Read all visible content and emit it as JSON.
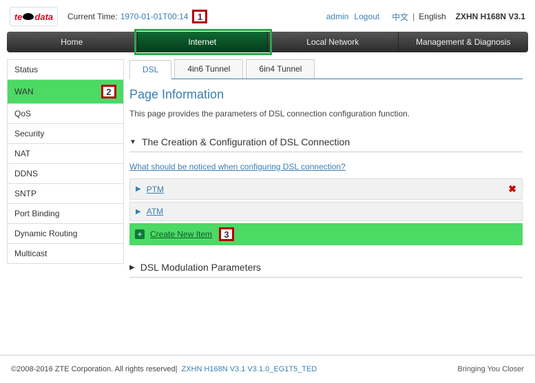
{
  "header": {
    "logo_te": "te",
    "logo_data": "data",
    "time_label": "Current Time:",
    "time_value": "1970-01-01T00:14",
    "user": "admin",
    "logout": "Logout",
    "lang_cn": "中文",
    "lang_en": "English",
    "model": "ZXHN H168N V3.1"
  },
  "steps": {
    "one": "1",
    "two": "2",
    "three": "3"
  },
  "nav": {
    "items": [
      {
        "label": "Home"
      },
      {
        "label": "Internet"
      },
      {
        "label": "Local Network"
      },
      {
        "label": "Management & Diagnosis"
      }
    ]
  },
  "sidebar": {
    "items": [
      {
        "label": "Status"
      },
      {
        "label": "WAN"
      },
      {
        "label": "QoS"
      },
      {
        "label": "Security"
      },
      {
        "label": "NAT"
      },
      {
        "label": "DDNS"
      },
      {
        "label": "SNTP"
      },
      {
        "label": "Port Binding"
      },
      {
        "label": "Dynamic Routing"
      },
      {
        "label": "Multicast"
      }
    ]
  },
  "tabs": [
    {
      "label": "DSL"
    },
    {
      "label": "4in6 Tunnel"
    },
    {
      "label": "6in4 Tunnel"
    }
  ],
  "page": {
    "title": "Page Information",
    "desc": "This page provides the parameters of DSL connection configuration function."
  },
  "section1": {
    "title": "The Creation & Configuration of DSL Connection",
    "help": "What should be noticed when configuring DSL connection?",
    "rows": [
      {
        "label": "PTM"
      },
      {
        "label": "ATM"
      }
    ],
    "create": "Create New Item"
  },
  "section2": {
    "title": "DSL Modulation Parameters"
  },
  "footer": {
    "copyright": "©2008-2016 ZTE Corporation. All rights reserved",
    "sep": "  |  ",
    "firmware": "ZXHN H168N V3.1 V3.1.0_EG1T5_TED",
    "slogan": "Bringing You Closer"
  }
}
